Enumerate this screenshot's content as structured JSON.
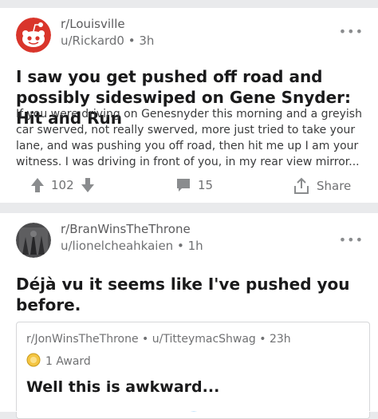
{
  "posts": [
    {
      "subreddit": "r/Louisville",
      "author": "u/Rickard0",
      "age": "3h",
      "title": "I saw you get pushed off road and possibly sideswiped on Gene Snyder: Hit and Run",
      "body": "If you were driving on Genesnyder this morning and a greyish car swerved, not really swerved, more just tried to take your lane, and was pushing you off road, then hit me up I am your witness. I was driving in front of you, in my rear view mirror...",
      "votes": "102",
      "comments": "15",
      "share_label": "Share",
      "menu": "•••"
    },
    {
      "subreddit": "r/BranWinsTheThrone",
      "author": "u/lionelcheahkaien",
      "age": "1h",
      "title": "Déjà vu it seems like I've pushed you before.",
      "menu": "•••",
      "crosspost": {
        "meta": "r/JonWinsTheThrone • u/TitteymacShwag • 23h",
        "award": "1 Award",
        "title": "Well this is awkward..."
      }
    }
  ],
  "colors": {
    "background": "#e9eaec",
    "card": "#ffffff",
    "snoo_red": "#d9352b",
    "muted_text": "#707173"
  },
  "icons": [
    "snoo-avatar-icon",
    "user-avatar-icon",
    "upvote-icon",
    "downvote-icon",
    "comment-icon",
    "share-icon",
    "award-icon",
    "more-options-icon"
  ]
}
